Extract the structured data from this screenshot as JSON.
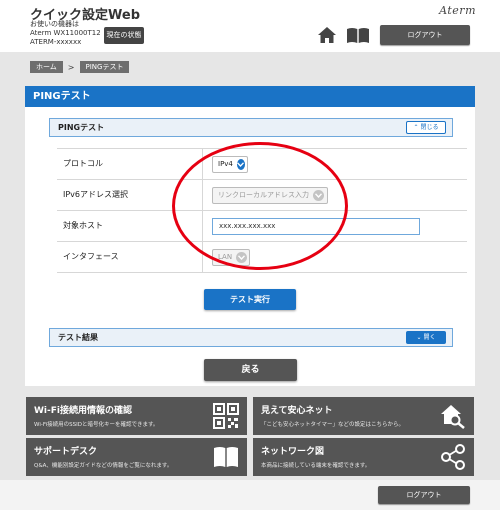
{
  "header": {
    "app_title": "クイック設定Web",
    "device_label": "お使いの機器は",
    "device_model": "Aterm WX11000T12",
    "device_id": "ATERM-xxxxxx",
    "status_button": "現在の状態",
    "logo": "Aterm",
    "logout_label": "ログアウト"
  },
  "breadcrumb": [
    "ホーム",
    "PINGテスト"
  ],
  "page_title": "PINGテスト",
  "ping_section": {
    "label": "PINGテスト",
    "toggle_label": "閉じる"
  },
  "form": {
    "protocol": {
      "label": "プロトコル",
      "value": "IPv4"
    },
    "ipv6_addr": {
      "label": "IPv6アドレス選択",
      "value": "リンクローカルアドレス入力"
    },
    "target_host": {
      "label": "対象ホスト",
      "value": "xxx.xxx.xxx.xxx"
    },
    "interface": {
      "label": "インタフェース",
      "value": "LAN"
    }
  },
  "run_button": "テスト実行",
  "result_section": {
    "label": "テスト結果",
    "toggle_label": "開く"
  },
  "back_button": "戻る",
  "tiles": [
    {
      "title": "Wi-Fi接続用情報の確認",
      "desc": "Wi-Fi接続用のSSIDと暗号化キーを確認できます。",
      "icon": "qr-code-icon"
    },
    {
      "title": "見えて安心ネット",
      "desc": "「こども安心ネットタイマー」などの設定はこちらから。",
      "icon": "house-search-icon"
    },
    {
      "title": "サポートデスク",
      "desc": "Q&A、機能別設定ガイドなどの情報をご覧になれます。",
      "icon": "book-icon"
    },
    {
      "title": "ネットワーク図",
      "desc": "本商品に接続している端末を確認できます。",
      "icon": "network-icon"
    }
  ],
  "footer": {
    "logout_label": "ログアウト"
  },
  "colors": {
    "accent": "#1a73c6",
    "annotation": "#e60012",
    "dark_button": "#555555"
  }
}
